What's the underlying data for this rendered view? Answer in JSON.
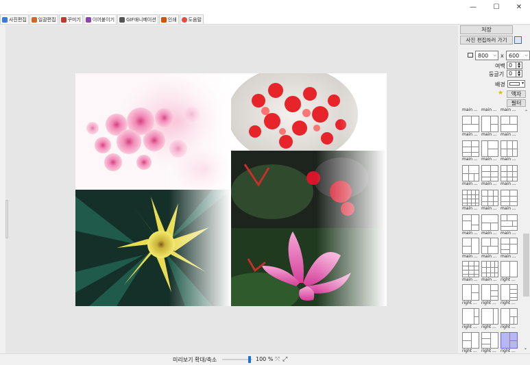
{
  "window": {
    "minimize": "—",
    "maximize": "☐",
    "close": "✕"
  },
  "tabs": [
    {
      "label": "사진편집",
      "color": "#3a7bd5"
    },
    {
      "label": "일괄편집",
      "color": "#c86a2a"
    },
    {
      "label": "꾸미기",
      "color": "#c0392b"
    },
    {
      "label": "이어붙이기",
      "color": "#8e44ad"
    },
    {
      "label": "GIF애니메이션",
      "color": "#555555"
    },
    {
      "label": "인쇄",
      "color": "#d35400"
    },
    {
      "label": "도움말",
      "color": "#e74c3c"
    }
  ],
  "panel": {
    "save": "저장",
    "goto_edit": "사진 편집하러 가기",
    "width": "800",
    "x_sep": "x",
    "height": "600",
    "margin_label": "여백",
    "margin_value": "0",
    "round_label": "둥글기",
    "round_value": "0",
    "bg_label": "배경",
    "frame_btn": "액자",
    "filter_btn": "필터"
  },
  "layout_captions": {
    "main": "main ...",
    "right": "right ..."
  },
  "status": {
    "zoom_label": "미리보기 확대/축소",
    "zoom_value": "100 %",
    "zoom_fraction": 0.95
  },
  "colors": {
    "accent": "#1e6fd0",
    "selected": "#b7b7f5"
  }
}
